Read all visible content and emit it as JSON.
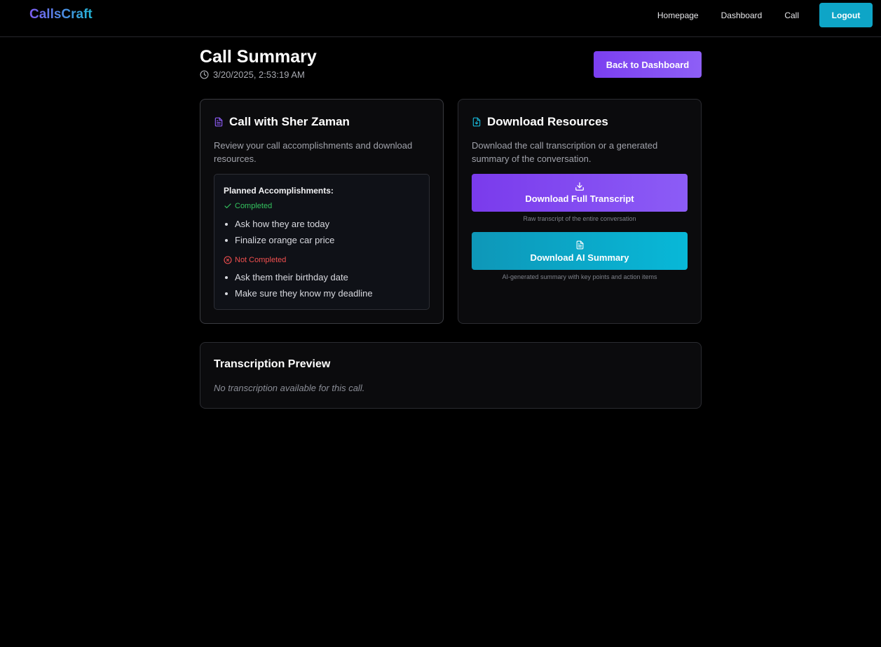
{
  "nav": {
    "brand": "CallsCraft",
    "links": [
      "Homepage",
      "Dashboard",
      "Call"
    ],
    "logout_label": "Logout"
  },
  "header": {
    "title": "Call Summary",
    "timestamp": "3/20/2025, 2:53:19 AM",
    "back_label": "Back to Dashboard"
  },
  "call_card": {
    "title": "Call with Sher Zaman",
    "description": "Review your call accomplishments and download resources.",
    "planned_title": "Planned Accomplishments:",
    "completed_label": "Completed",
    "completed_items": [
      "Ask how they are today",
      "Finalize orange car price"
    ],
    "not_completed_label": "Not Completed",
    "not_completed_items": [
      "Ask them their birthday date",
      "Make sure they know my deadline"
    ]
  },
  "downloads_card": {
    "title": "Download Resources",
    "description": "Download the call transcription or a generated summary of the conversation.",
    "transcript_label": "Download Full Transcript",
    "transcript_caption": "Raw transcript of the entire conversation",
    "summary_label": "Download AI Summary",
    "summary_caption": "AI-generated summary with key points and action items"
  },
  "transcription": {
    "title": "Transcription Preview",
    "empty_text": "No transcription available for this call."
  },
  "colors": {
    "accent_purple": "#7b3ff0",
    "accent_cyan": "#0ea5c7",
    "success": "#34c35f",
    "danger": "#f04f4f"
  },
  "icons": {
    "timestamp": "clock-icon",
    "call_card": "document-icon",
    "downloads_card": "file-download-icon",
    "completed": "check-icon",
    "not_completed": "x-circle-icon",
    "transcript_button": "download-icon",
    "summary_button": "file-text-icon"
  }
}
